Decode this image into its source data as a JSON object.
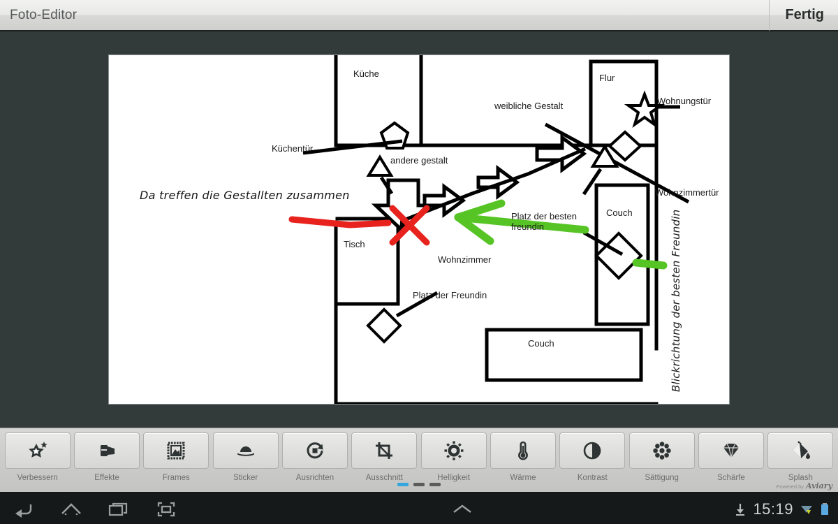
{
  "titlebar": {
    "app_title": "Foto-Editor",
    "done_label": "Fertig"
  },
  "canvas": {
    "title": "floor-plan-sketch",
    "labels": {
      "kueche": "Küche",
      "kuechentuer": "Küchentür",
      "weibliche_gestalt": "weibliche Gestalt",
      "flur": "Flur",
      "wohnungstuer": "Wohnungstür",
      "andere_gestalt": "andere gestalt",
      "annotation_red": "Da treffen die Gestallten zusammen",
      "tisch": "Tisch",
      "platz_der_besten_freundin": "Platz der besten\nfreundin",
      "couch_right": "Couch",
      "wohnzimmer": "Wohnzimmer",
      "platz_der_freundin": "Platz der Freundin",
      "wohnzimmertuer": "Wohnzimmertür",
      "blickrichtung": "Blickrichtung der besten Freundin",
      "couch_bottom": "Couch"
    },
    "colors": {
      "ink": "#000000",
      "red_marker": "#e8221c",
      "green_marker": "#56c424",
      "paper": "#ffffff",
      "stage": "#333a3a"
    }
  },
  "toolstrip": {
    "tools": [
      {
        "label": "Verbessern",
        "icon": "magic-star-icon"
      },
      {
        "label": "Effekte",
        "icon": "effects-icon"
      },
      {
        "label": "Frames",
        "icon": "frame-icon"
      },
      {
        "label": "Sticker",
        "icon": "sticker-icon"
      },
      {
        "label": "Ausrichten",
        "icon": "rotate-icon"
      },
      {
        "label": "Ausschnitt",
        "icon": "crop-icon"
      },
      {
        "label": "Helligkeit",
        "icon": "brightness-sun-icon"
      },
      {
        "label": "Wärme",
        "icon": "thermometer-icon"
      },
      {
        "label": "Kontrast",
        "icon": "contrast-circle-icon"
      },
      {
        "label": "Sättigung",
        "icon": "saturation-dots-icon"
      },
      {
        "label": "Schärfe",
        "icon": "diamond-icon"
      },
      {
        "label": "Splash",
        "icon": "paint-bucket-icon"
      }
    ],
    "pages": {
      "count": 3,
      "active_index": 0
    },
    "powered_prefix": "Powered by",
    "powered_brand": "Aviary",
    "accent_color": "#33a6e0"
  },
  "navbar": {
    "buttons": [
      {
        "name": "back-icon"
      },
      {
        "name": "home-icon"
      },
      {
        "name": "recents-icon"
      },
      {
        "name": "screenshot-icon"
      }
    ],
    "center": {
      "name": "chevron-up-icon"
    },
    "status": {
      "download_icon": "download-icon",
      "clock": "15:19",
      "wifi_icon": "wifi-icon",
      "battery_icon": "battery-icon"
    }
  }
}
